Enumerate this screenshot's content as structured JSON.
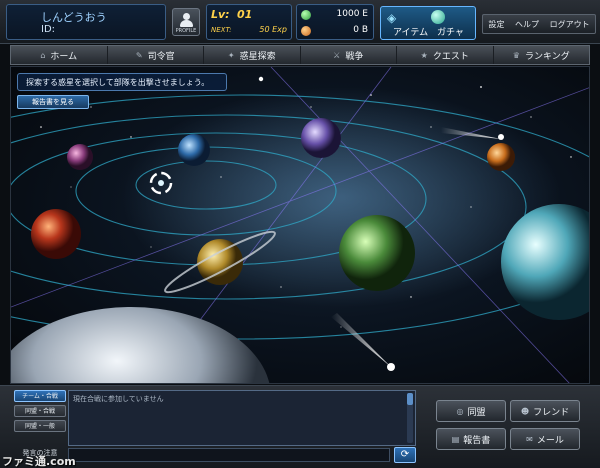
{
  "player": {
    "name": "しんどうおう",
    "id_label": "ID:",
    "profile_label": "PROFILE"
  },
  "level": {
    "lv_label": "Lv:",
    "lv_value": "01",
    "next_label": "NEXT:",
    "next_value": "50 Exp"
  },
  "currency": {
    "money": "1000 E",
    "gems": "0 B"
  },
  "shop": {
    "item_label": "アイテム",
    "gacha_label": "ガチャ"
  },
  "system_menu": [
    "設定",
    "ヘルプ",
    "ログアウト"
  ],
  "nav": [
    {
      "label": "ホーム",
      "icon": "home-icon"
    },
    {
      "label": "司令官",
      "icon": "commander-icon"
    },
    {
      "label": "惑星探索",
      "icon": "planet-icon"
    },
    {
      "label": "戦争",
      "icon": "war-icon"
    },
    {
      "label": "クエスト",
      "icon": "quest-star-icon"
    },
    {
      "label": "ランキング",
      "icon": "crown-icon"
    }
  ],
  "map": {
    "instruction": "探索する惑星を選択して部隊を出撃させましょう。",
    "report_button": "報告書を見る"
  },
  "chat": {
    "tabs": [
      "チーム・合戦",
      "同盟・合戦",
      "同盟・一般"
    ],
    "active_tab": "チーム・合戦",
    "message": "現在合戦に参加していません",
    "notes_label": "発言の注意"
  },
  "actions": {
    "alliance": "同盟",
    "friend": "フレンド",
    "report": "報告書",
    "mail": "メール"
  },
  "watermark": "ファミ通.com",
  "colors": {
    "accent": "#2f72b8",
    "gold": "#ffd24a",
    "orbit": "#2fa9c8"
  }
}
